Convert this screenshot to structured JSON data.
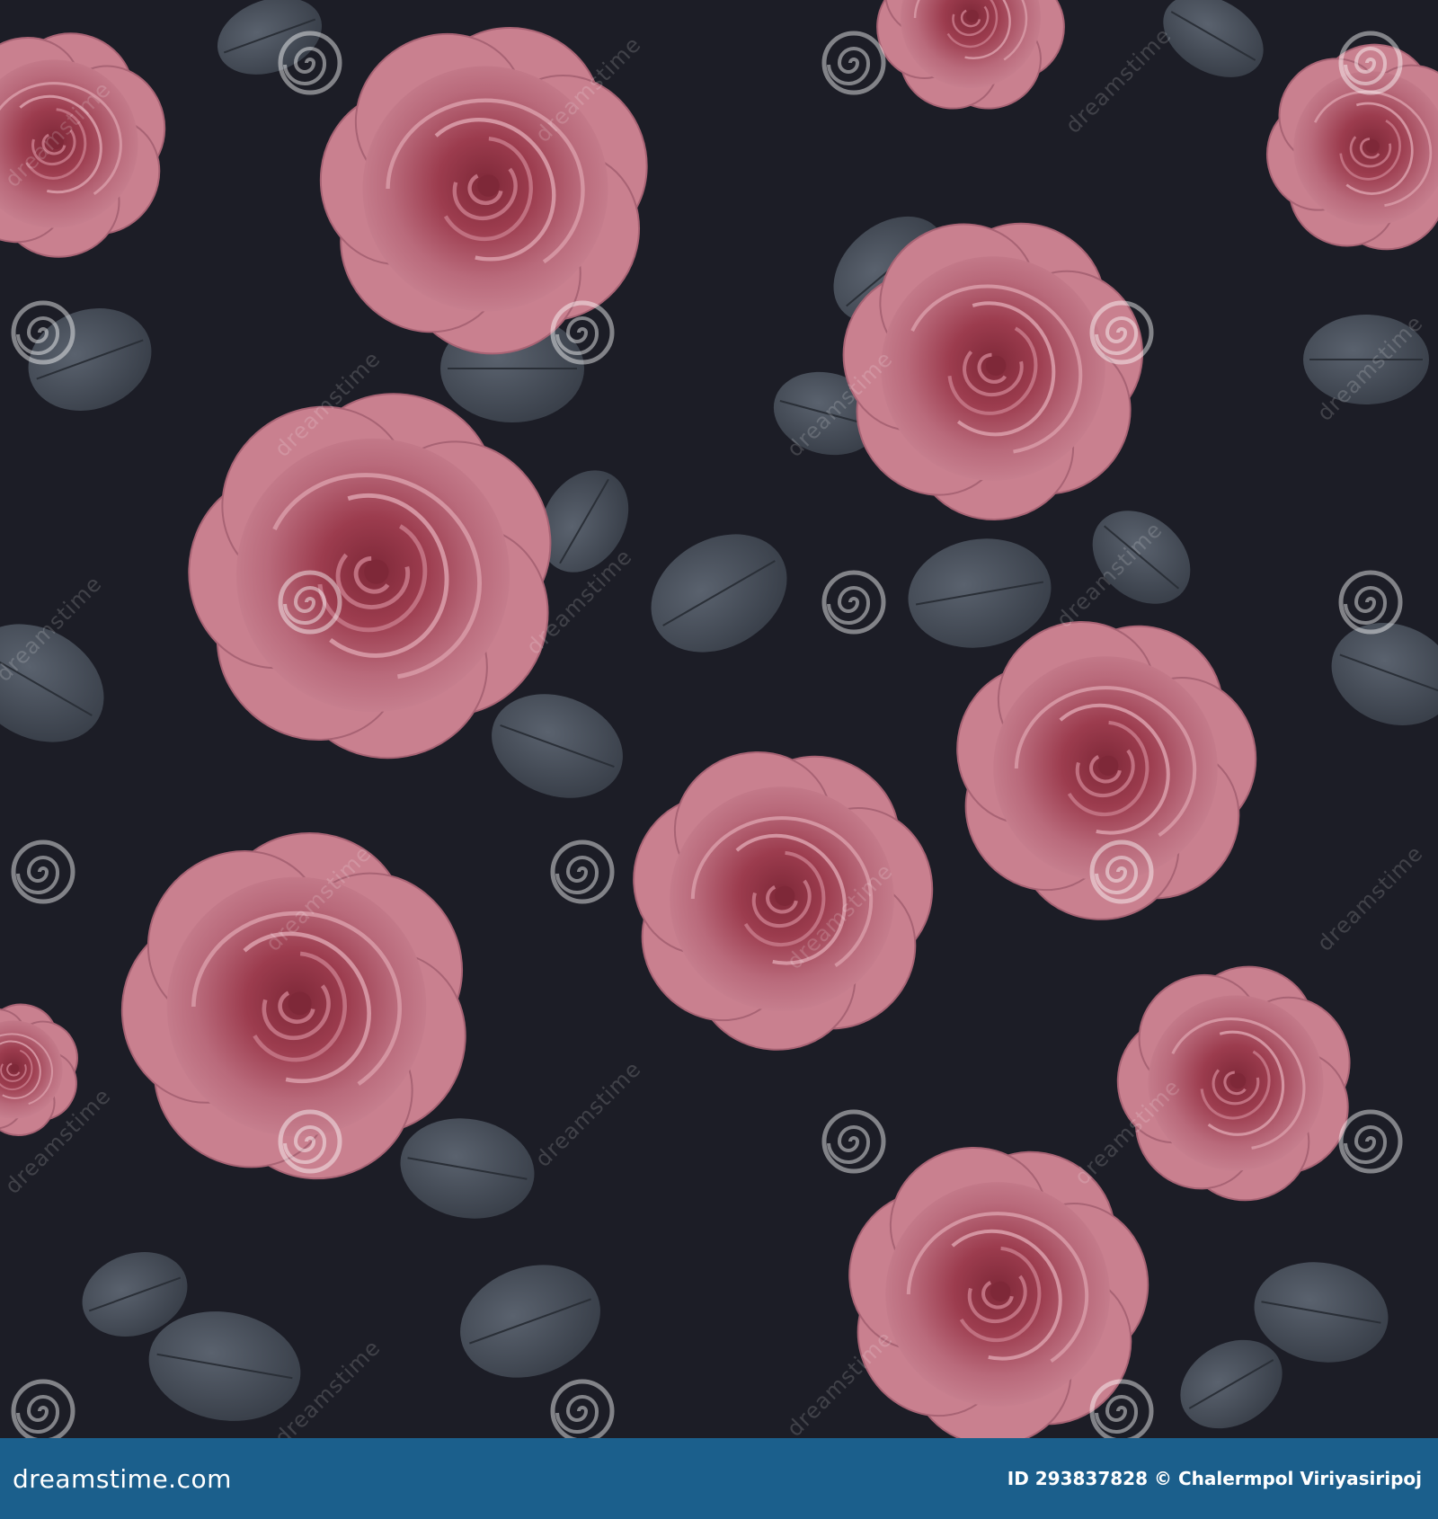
{
  "image": {
    "subject": "seamless pattern of dusty pink roses with dark grey leaves",
    "background_color": "#1c1d26",
    "petal_light": "#c9808f",
    "petal_mid": "#b05a6c",
    "petal_dark": "#7e2838",
    "leaf_color": "#4a525e"
  },
  "watermark": {
    "text": "dreamstime",
    "icon": "spiral-icon"
  },
  "footer": {
    "brand": "dreamstime.com",
    "id_label": "ID",
    "id_value": "293837828",
    "copyright_symbol": "©",
    "author": "Chalermpol Viriyasiripoj"
  }
}
